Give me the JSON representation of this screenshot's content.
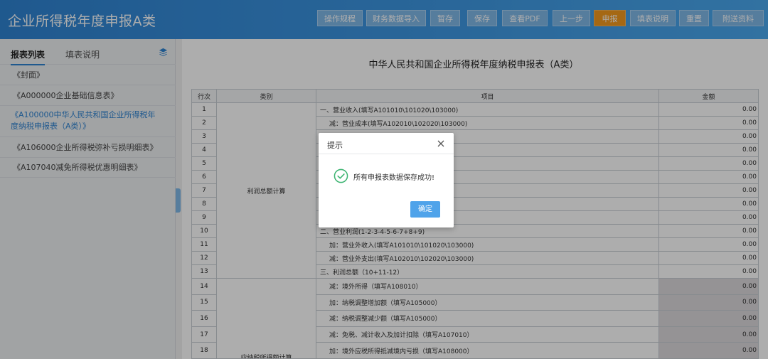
{
  "header": {
    "title": "企业所得税年度申报A类",
    "buttons": [
      "操作规程",
      "财务数据导入",
      "暂存",
      "保存",
      "查看PDF",
      "上一步",
      "申报",
      "填表说明",
      "重置",
      "附送资料"
    ]
  },
  "sidebar": {
    "tabs": [
      "报表列表",
      "填表说明"
    ],
    "items": [
      {
        "label": "《封面》"
      },
      {
        "label": "《A000000企业基础信息表》"
      },
      {
        "label": "《A100000中华人民共和国企业所得税年度纳税申报表（A类）》"
      },
      {
        "label": "《A106000企业所得税弥补亏损明细表》"
      },
      {
        "label": "《A107040减免所得税优惠明细表》"
      }
    ]
  },
  "form": {
    "title": "中华人民共和国企业所得税年度纳税申报表（A类）",
    "headers": {
      "row": "行次",
      "category": "类别",
      "item": "项目",
      "amount": "金额"
    },
    "categories": [
      "利润总额计算",
      "应纳税所得额计算"
    ],
    "rows": [
      {
        "n": "1",
        "item": "一、营业收入(填写A101010\\101020\\103000)",
        "amount": "0.00"
      },
      {
        "n": "2",
        "item": "减：营业成本(填写A102010\\102020\\103000)",
        "amount": "0.00"
      },
      {
        "n": "3",
        "item": "",
        "amount": "0.00"
      },
      {
        "n": "4",
        "item": "",
        "amount": "0.00"
      },
      {
        "n": "5",
        "item": "",
        "amount": "0.00"
      },
      {
        "n": "6",
        "item": "",
        "amount": "0.00"
      },
      {
        "n": "7",
        "item": "",
        "amount": "0.00"
      },
      {
        "n": "8",
        "item": "",
        "amount": "0.00"
      },
      {
        "n": "9",
        "item": "",
        "amount": "0.00"
      },
      {
        "n": "10",
        "item": "二、营业利润(1-2-3-4-5-6-7+8+9)",
        "amount": "0.00"
      },
      {
        "n": "11",
        "item": "加：营业外收入(填写A101010\\101020\\103000)",
        "amount": "0.00"
      },
      {
        "n": "12",
        "item": "减：营业外支出(填写A102010\\102020\\103000)",
        "amount": "0.00"
      },
      {
        "n": "13",
        "item": "三、利润总额（10+11-12）",
        "amount": "0.00"
      },
      {
        "n": "14",
        "item": "减：境外所得（填写A108010）",
        "amount": "0.00"
      },
      {
        "n": "15",
        "item": "加：纳税调整增加额（填写A105000）",
        "amount": "0.00"
      },
      {
        "n": "16",
        "item": "减：纳税调整减少额（填写A105000）",
        "amount": "0.00"
      },
      {
        "n": "17",
        "item": "减：免税、减计收入及加计扣除（填写A107010）",
        "amount": "0.00"
      },
      {
        "n": "18",
        "item": "加：境外应税所得抵减境内亏损（填写A108000）",
        "amount": "0.00"
      }
    ]
  },
  "dialog": {
    "title": "提示",
    "message": "所有申报表数据保存成功!",
    "ok_label": "确定"
  },
  "colors": {
    "header_blue": "#3d97e2",
    "primary_orange": "#f39a1e",
    "link_blue": "#2f83d2",
    "success_green": "#3fb573",
    "readonly_grey": "#dcd9dc"
  }
}
